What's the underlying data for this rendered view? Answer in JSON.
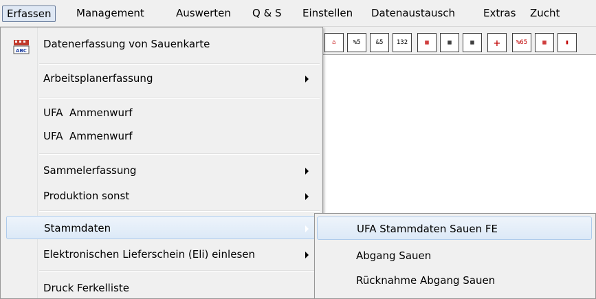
{
  "menubar": {
    "items": [
      {
        "label": "Erfassen"
      },
      {
        "label": "Management"
      },
      {
        "label": "Auswerten"
      },
      {
        "label": "Q & S"
      },
      {
        "label": "Einstellen"
      },
      {
        "label": "Datenaustausch"
      },
      {
        "label": "Extras"
      },
      {
        "label": "Zucht"
      }
    ]
  },
  "toolbar": {
    "buttons": [
      {
        "icon": "home-pen-icon",
        "glyph": "⌂"
      },
      {
        "icon": "sows-list-icon",
        "glyph": "%5"
      },
      {
        "icon": "sows-list-alt-icon",
        "glyph": "&5"
      },
      {
        "icon": "numbers-pig-icon",
        "glyph": "132"
      },
      {
        "icon": "piglets-grid-icon",
        "glyph": "▦"
      },
      {
        "icon": "piglets-grid-2-icon",
        "glyph": "▦"
      },
      {
        "icon": "litter-grid-icon",
        "glyph": "▦"
      },
      {
        "icon": "add-record-icon",
        "glyph": "+"
      },
      {
        "icon": "weight-icon",
        "glyph": "%65"
      },
      {
        "icon": "breeding-grid-icon",
        "glyph": "▦"
      },
      {
        "icon": "more-icon",
        "glyph": "▮"
      }
    ]
  },
  "dropdown": {
    "items": [
      {
        "label": "Datenerfassung von Sauenkarte",
        "has_submenu": false,
        "icon": "sow-card-abc-icon"
      },
      {
        "label": "Arbeitsplanerfassung",
        "has_submenu": true
      },
      {
        "label": "UFA  Ammenwurf",
        "has_submenu": false
      },
      {
        "label": "UFA  Ammenwurf",
        "has_submenu": false
      },
      {
        "label": "Sammelerfassung",
        "has_submenu": true
      },
      {
        "label": "Produktion sonst",
        "has_submenu": true
      },
      {
        "label": "Stammdaten",
        "has_submenu": true,
        "highlighted": true
      },
      {
        "label": "Elektronischen Lieferschein (Eli) einlesen",
        "has_submenu": true
      },
      {
        "label": "Druck Ferkelliste",
        "has_submenu": false
      }
    ]
  },
  "submenu": {
    "items": [
      {
        "label": "UFA Stammdaten Sauen FE",
        "highlighted": true
      },
      {
        "label": "Abgang Sauen"
      },
      {
        "label": "Rücknahme Abgang Sauen"
      }
    ]
  }
}
